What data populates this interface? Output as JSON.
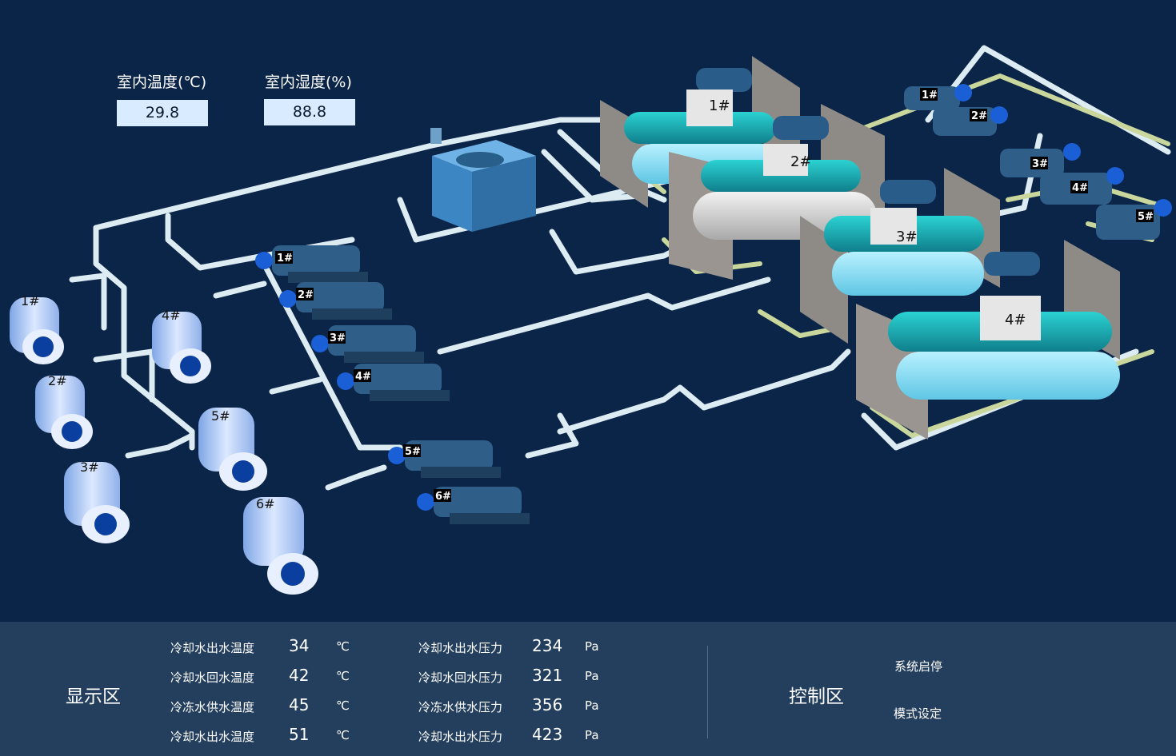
{
  "sensors": {
    "temperature": {
      "label": "室内温度(℃)",
      "value": "29.8"
    },
    "humidity": {
      "label": "室内湿度(%)",
      "value": "88.8"
    }
  },
  "equipment": {
    "cooling_towers": [
      "1#",
      "2#",
      "3#",
      "4#",
      "5#",
      "6#"
    ],
    "pumps": [
      "1#",
      "2#",
      "3#",
      "4#",
      "5#",
      "6#"
    ],
    "chillers": [
      "1#",
      "2#",
      "3#",
      "4#"
    ],
    "right_pumps": [
      "1#",
      "2#",
      "3#",
      "4#",
      "5#"
    ]
  },
  "display": {
    "title": "显示区",
    "left_rows": [
      {
        "label": "冷却水出水温度",
        "value": "34",
        "unit": "℃"
      },
      {
        "label": "冷却水回水温度",
        "value": "42",
        "unit": "℃"
      },
      {
        "label": "冷冻水供水温度",
        "value": "45",
        "unit": "℃"
      },
      {
        "label": "冷却水出水温度",
        "value": "51",
        "unit": "℃"
      }
    ],
    "right_rows": [
      {
        "label": "冷却水出水压力",
        "value": "234",
        "unit": "Pa"
      },
      {
        "label": "冷却水回水压力",
        "value": "321",
        "unit": "Pa"
      },
      {
        "label": "冷冻水供水压力",
        "value": "356",
        "unit": "Pa"
      },
      {
        "label": "冷却水出水压力",
        "value": "423",
        "unit": "Pa"
      }
    ]
  },
  "control": {
    "title": "控制区",
    "start_stop": "系统启停",
    "mode": "模式设定"
  }
}
